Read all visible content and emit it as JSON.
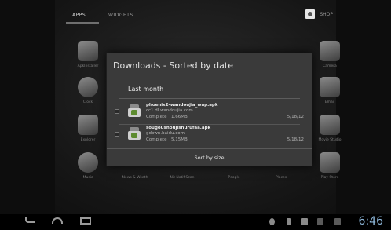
{
  "launcher": {
    "tabs": {
      "apps": "APPS",
      "widgets": "WIDGETS"
    },
    "shop_label": "SHOP",
    "apps": [
      {
        "label": "ApkInstaller",
        "icon": "package-icon"
      },
      {
        "label": "Clock",
        "icon": "clock-icon"
      },
      {
        "label": "Explorer",
        "icon": "folder-icon"
      },
      {
        "label": "Music",
        "icon": "music-icon"
      },
      {
        "label": "News & Weath",
        "icon": "news-icon"
      },
      {
        "label": "Nit Notif Scan",
        "icon": "scan-icon"
      },
      {
        "label": "People",
        "icon": "people-icon"
      },
      {
        "label": "Places",
        "icon": "places-icon"
      },
      {
        "label": "Camera",
        "icon": "camera-icon"
      },
      {
        "label": "Email",
        "icon": "email-icon"
      },
      {
        "label": "Movie Studio",
        "icon": "film-icon"
      },
      {
        "label": "Play Store",
        "icon": "play-store-icon"
      }
    ]
  },
  "dialog": {
    "title": "Downloads - Sorted by date",
    "section": "Last month",
    "items": [
      {
        "filename": "phoenix2-wandoujia_wap.apk",
        "host": "cc1.dl.wandoujia.com",
        "status": "Complete",
        "size": "1.66MB",
        "date": "5/18/12"
      },
      {
        "filename": "sougoushoujishurufaa.apk",
        "host": "gdown.baidu.com",
        "status": "Complete",
        "size": "5.15MB",
        "date": "5/18/12"
      }
    ],
    "sort_button": "Sort by size"
  },
  "system_bar": {
    "time": "6:46"
  }
}
